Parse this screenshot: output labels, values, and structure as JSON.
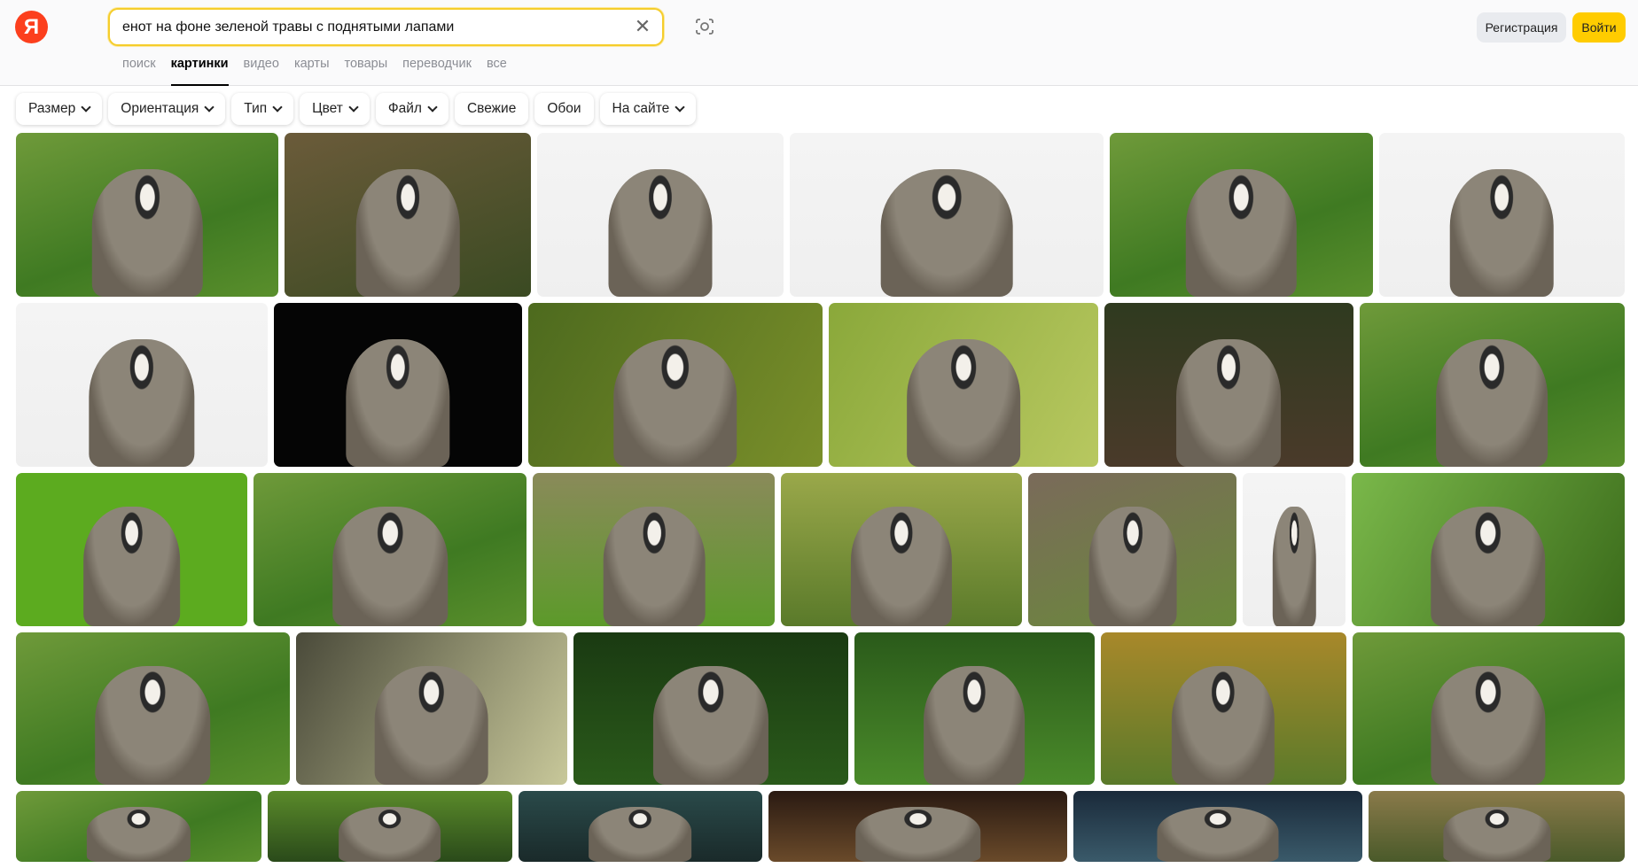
{
  "header": {
    "logo": "Я",
    "search_value": "енот на фоне зеленой травы с поднятыми лапами",
    "register_label": "Регистрация",
    "login_label": "Войти"
  },
  "tabs": [
    {
      "label": "поиск"
    },
    {
      "label": "картинки",
      "active": true
    },
    {
      "label": "видео"
    },
    {
      "label": "карты"
    },
    {
      "label": "товары"
    },
    {
      "label": "переводчик"
    },
    {
      "label": "все"
    }
  ],
  "filters": [
    {
      "label": "Размер",
      "dropdown": true
    },
    {
      "label": "Ориентация",
      "dropdown": true
    },
    {
      "label": "Тип",
      "dropdown": true
    },
    {
      "label": "Цвет",
      "dropdown": true
    },
    {
      "label": "Файл",
      "dropdown": true
    },
    {
      "label": "Свежие",
      "dropdown": false
    },
    {
      "label": "Обои",
      "dropdown": false
    },
    {
      "label": "На сайте",
      "dropdown": true
    }
  ],
  "colors": {
    "accent": "#ffcc00",
    "logo": "#fc3f1d",
    "search_border": "#f5cd2b"
  }
}
